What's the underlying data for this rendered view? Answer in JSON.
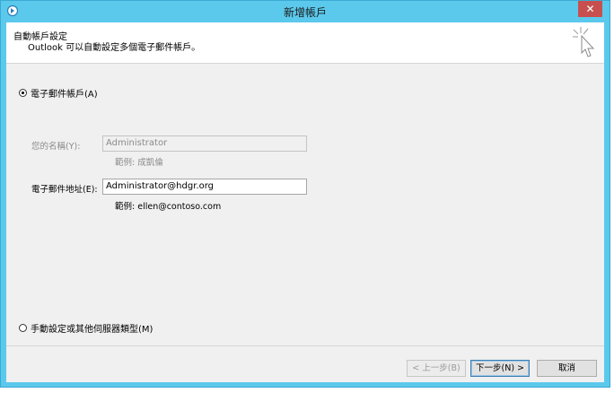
{
  "window": {
    "title": "新增帳戶",
    "close_label": "✕"
  },
  "header": {
    "title": "自動帳戶設定",
    "subtitle": "Outlook 可以自動設定多個電子郵件帳戶。",
    "icon": "cursor-sparkle-icon"
  },
  "email_account": {
    "radio_label": "電子郵件帳戶(A)",
    "selected": true,
    "name": {
      "label": "您的名稱(Y):",
      "value": "Administrator",
      "example": "範例: 成凱倫",
      "disabled": true
    },
    "email": {
      "label": "電子郵件地址(E):",
      "value": "Administrator@hdgr.org",
      "example": "範例: ellen@contoso.com"
    }
  },
  "manual": {
    "radio_label": "手動設定或其他伺服器類型(M)",
    "selected": false
  },
  "buttons": {
    "back": "< 上一步(B)",
    "next": "下一步(N) >",
    "cancel": "取消"
  },
  "colors": {
    "frame": "#5bc9ec",
    "close": "#c7504f",
    "client": "#f0f0f0"
  }
}
